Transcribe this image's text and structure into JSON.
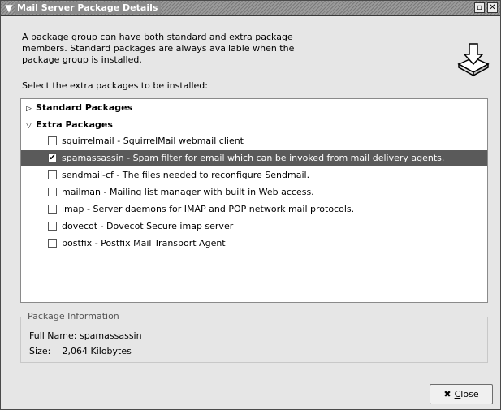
{
  "window": {
    "title": "Mail Server Package Details"
  },
  "description": "A package group can have both standard and extra package members.  Standard packages are always available when the package group is installed.",
  "select_label": "Select the extra packages to be installed:",
  "groups": {
    "standard": "Standard Packages",
    "extra": "Extra Packages"
  },
  "packages": [
    {
      "label": "squirrelmail - SquirrelMail webmail client",
      "checked": false
    },
    {
      "label": "spamassassin - Spam filter for email which can be invoked from mail delivery agents.",
      "checked": true
    },
    {
      "label": "sendmail-cf - The files needed to reconfigure Sendmail.",
      "checked": false
    },
    {
      "label": "mailman - Mailing list manager with built in Web access.",
      "checked": false
    },
    {
      "label": "imap - Server daemons for IMAP and POP network mail protocols.",
      "checked": false
    },
    {
      "label": "dovecot - Dovecot Secure imap server",
      "checked": false
    },
    {
      "label": "postfix - Postfix Mail Transport Agent",
      "checked": false
    }
  ],
  "info": {
    "legend": "Package Information",
    "full_name_label": "Full Name:",
    "full_name": "spamassassin",
    "size_label": "Size:",
    "size": "2,064 Kilobytes"
  },
  "close_button": {
    "icon": "✖",
    "label_underlined": "C",
    "label_rest": "lose"
  },
  "colors": {
    "selected_row": "#5a5a5a",
    "titlebar": "#8a8a8a"
  }
}
